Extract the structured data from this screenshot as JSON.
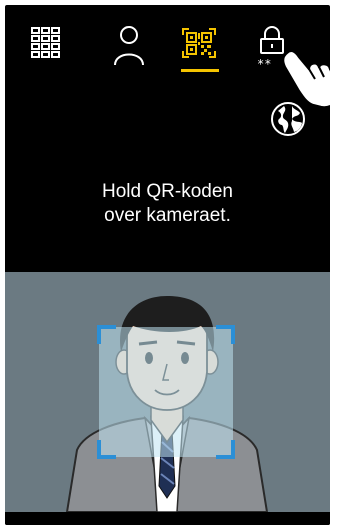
{
  "toolbar": {
    "tabs": [
      {
        "id": "keypad",
        "icon": "keypad-grid-icon",
        "active": false
      },
      {
        "id": "user",
        "icon": "person-icon",
        "active": false
      },
      {
        "id": "qr",
        "icon": "qr-code-icon",
        "active": true
      },
      {
        "id": "pin",
        "icon": "lock-pin-icon",
        "active": false
      }
    ],
    "language_icon": "globe-icon",
    "pointer_icon": "pointing-hand-icon",
    "colors": {
      "active": "#f5c400",
      "icon": "#ffffff",
      "background": "#000000"
    }
  },
  "main": {
    "instruction_line1": "Hold QR-koden",
    "instruction_line2": "over kameraet."
  },
  "camera_view": {
    "subject": "person-face-illustration",
    "frame_icon": "face-detection-frame",
    "colors": {
      "background": "#6b7a82",
      "frame": "#2b8fd6",
      "frame_fill": "#bfe3f2"
    }
  }
}
